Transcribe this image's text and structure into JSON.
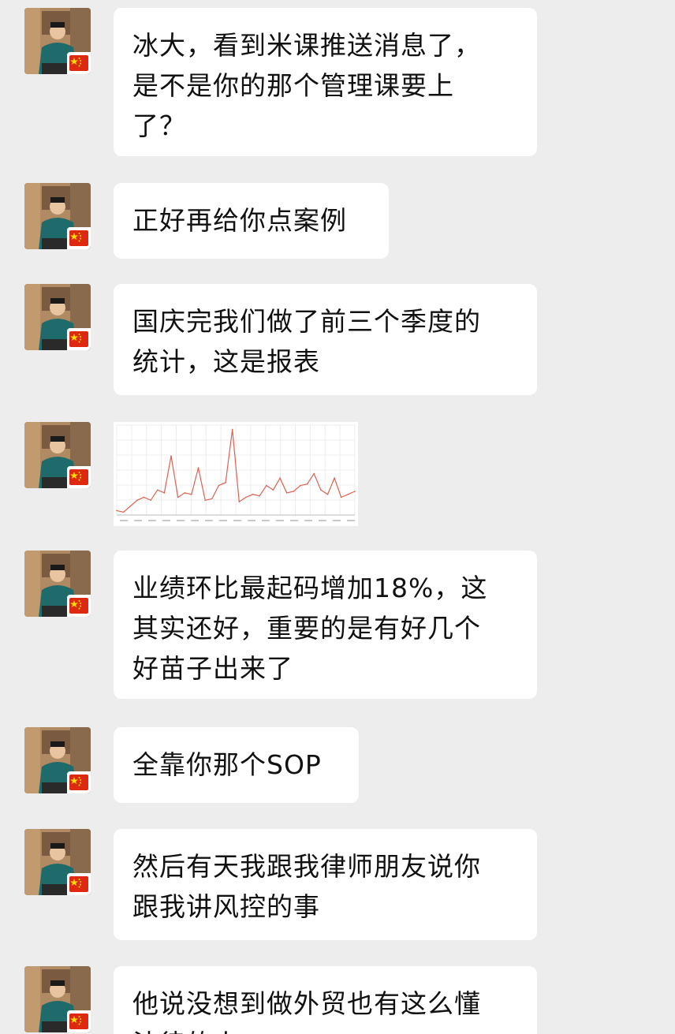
{
  "messages": [
    {
      "text": "冰大，看到米课推送消息了，\n是不是你的那个管理课要上\n了？"
    },
    {
      "text": "正好再给你点案例"
    },
    {
      "text": "国庆完我们做了前三个季度的\n统计，这是报表"
    },
    {
      "image": "sales-line-chart"
    },
    {
      "text": "业绩环比最起码增加18%，这\n其实还好，重要的是有好几个\n好苗子出来了"
    },
    {
      "text": "全靠你那个SOP"
    },
    {
      "text": "然后有天我跟我律师朋友说你\n跟我讲风控的事"
    },
    {
      "text": "他说没想到做外贸也有这么懂\n法律的人"
    }
  ],
  "avatar": {
    "icon": "user-avatar-photo",
    "badge": "china-flag-icon",
    "badge_color": "#de2910"
  },
  "chart_data": {
    "type": "line",
    "color": "#e06050",
    "grid": true,
    "values": [
      3,
      2,
      6,
      10,
      12,
      10,
      17,
      15,
      40,
      12,
      15,
      14,
      32,
      10,
      11,
      20,
      22,
      58,
      9,
      12,
      14,
      13,
      20,
      17,
      25,
      15,
      16,
      20,
      21,
      28,
      17,
      14,
      25,
      12,
      14,
      16
    ]
  }
}
